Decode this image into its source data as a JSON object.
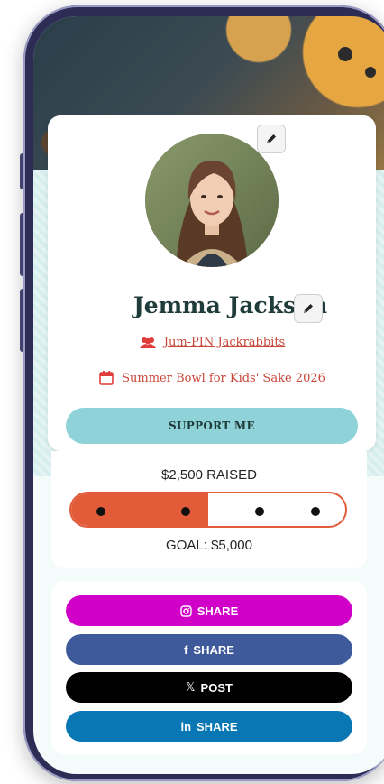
{
  "profile": {
    "name": "Jemma Jackson",
    "team": "Jum-PIN Jackrabbits",
    "event": "Summer Bowl for Kids' Sake 2026",
    "support_label": "SUPPORT ME"
  },
  "progress": {
    "raised_label": "$2,500 RAISED",
    "goal_label": "GOAL: $5,000",
    "fraction": 0.5
  },
  "share": {
    "instagram": {
      "label": "SHARE",
      "icon": "instagram-icon",
      "color": "#d100c8"
    },
    "facebook": {
      "label": "SHARE",
      "icon": "facebook-icon",
      "glyph": "f",
      "color": "#3f5a9b"
    },
    "x": {
      "label": "POST",
      "icon": "x-icon",
      "glyph": "𝕏",
      "color": "#000000"
    },
    "linkedin": {
      "label": "SHARE",
      "icon": "linkedin-icon",
      "glyph": "in",
      "color": "#0a77b5"
    }
  },
  "colors": {
    "accent_teal": "#8fd3d8",
    "accent_orange": "#e25c3a",
    "link_red": "#c9463a",
    "name_dark": "#1f3b3a"
  }
}
